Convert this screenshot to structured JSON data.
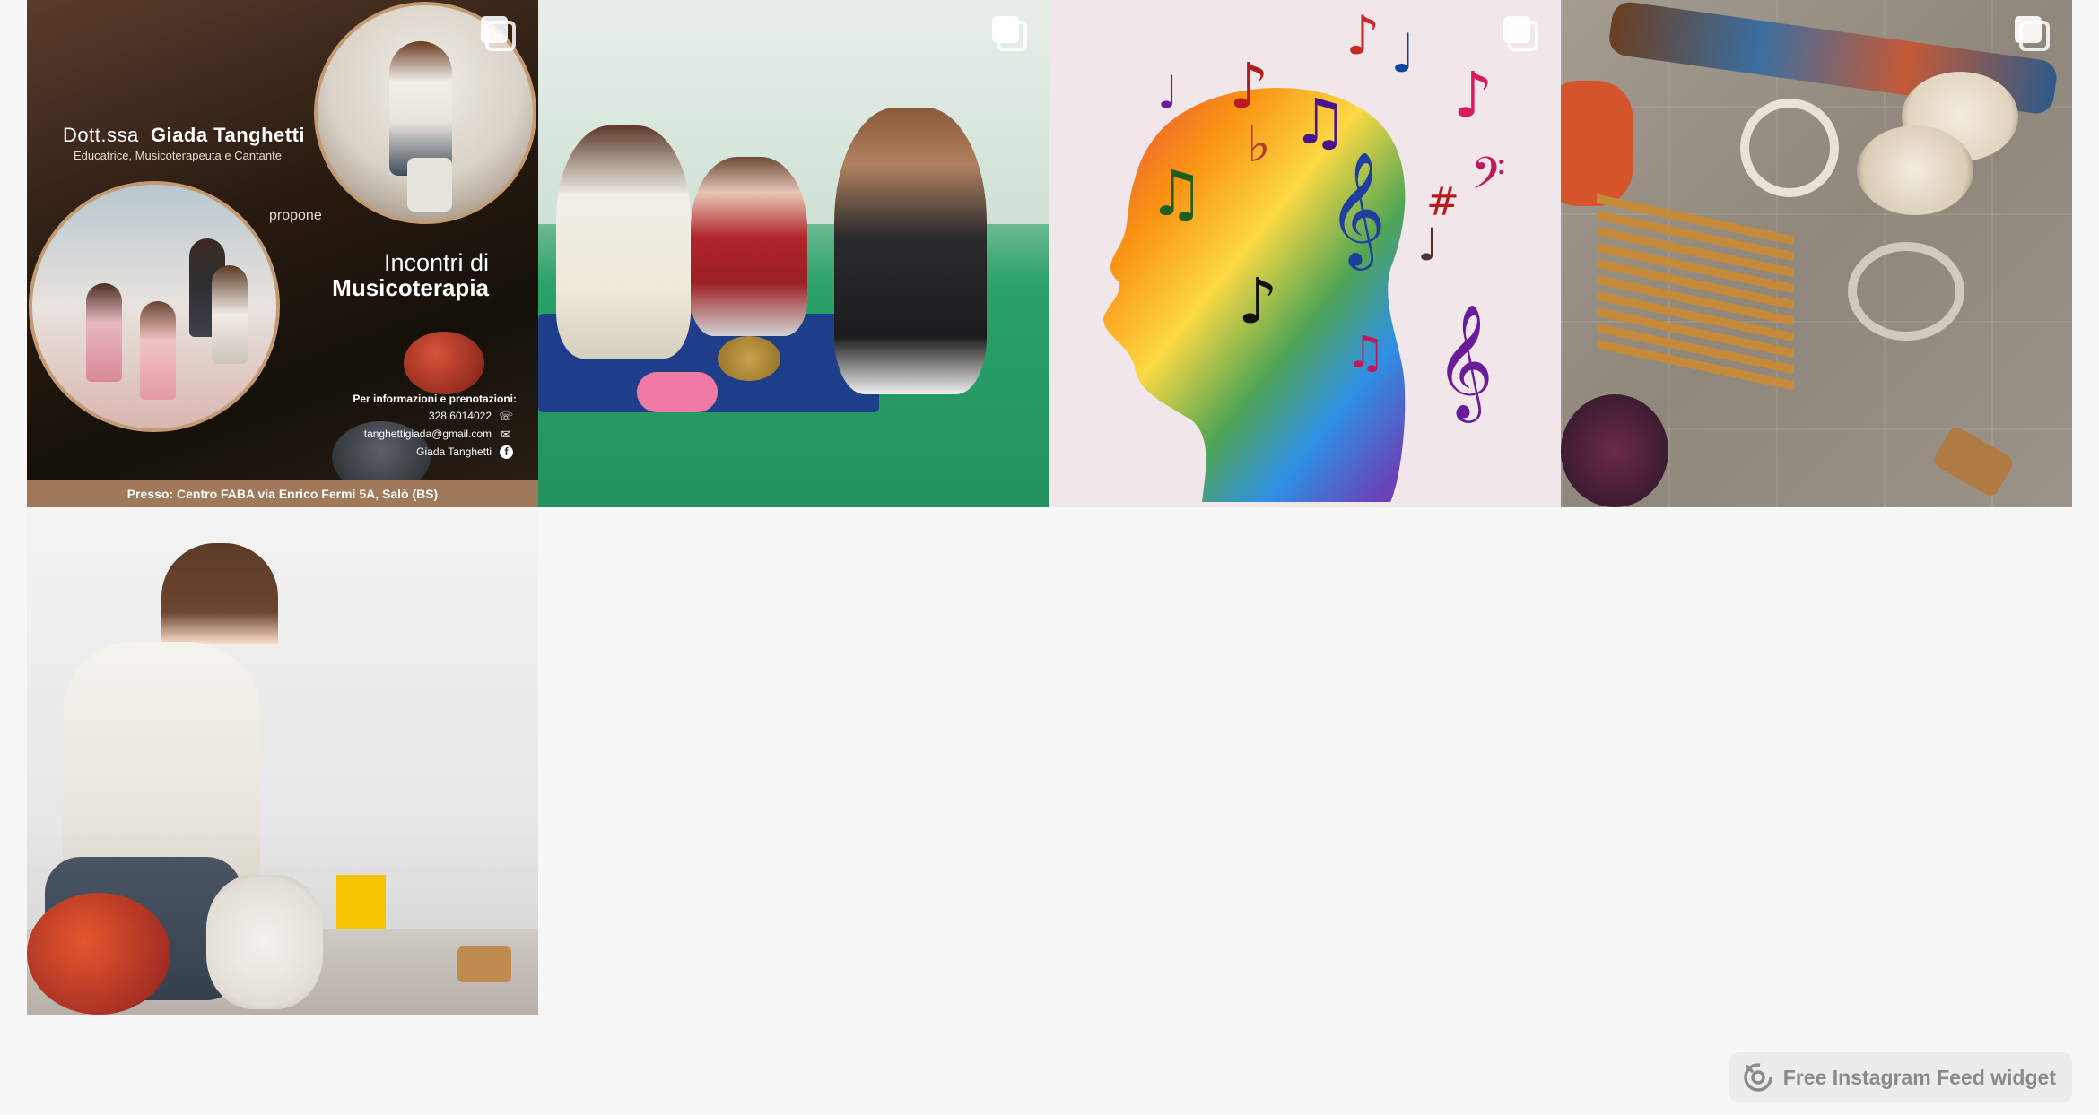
{
  "feed": {
    "posts": [
      {
        "type": "carousel",
        "kind": "poster",
        "poster": {
          "name_prefix": "Dott.ssa",
          "name": "Giada Tanghetti",
          "subtitle": "Educatrice, Musicoterapeuta e Cantante",
          "propone": "propone",
          "title_line1": "Incontri di",
          "title_line2": "Musicoterapia",
          "info_heading": "Per informazioni e prenotazioni:",
          "phone": "328 6014022",
          "email": "tanghettigiada@gmail.com",
          "facebook": "Giada Tanghetti",
          "footer": "Presso: Centro FABA via Enrico Fermi 5A, Salò (BS)"
        }
      },
      {
        "type": "carousel",
        "kind": "photo-children-playing"
      },
      {
        "type": "carousel",
        "kind": "illustration-music-head"
      },
      {
        "type": "carousel",
        "kind": "photo-instruments"
      },
      {
        "type": "single",
        "kind": "photo-woman-drum"
      }
    ]
  },
  "widget_badge": {
    "label": "Free Instagram Feed widget",
    "icon": "elfsight-logo-icon"
  }
}
